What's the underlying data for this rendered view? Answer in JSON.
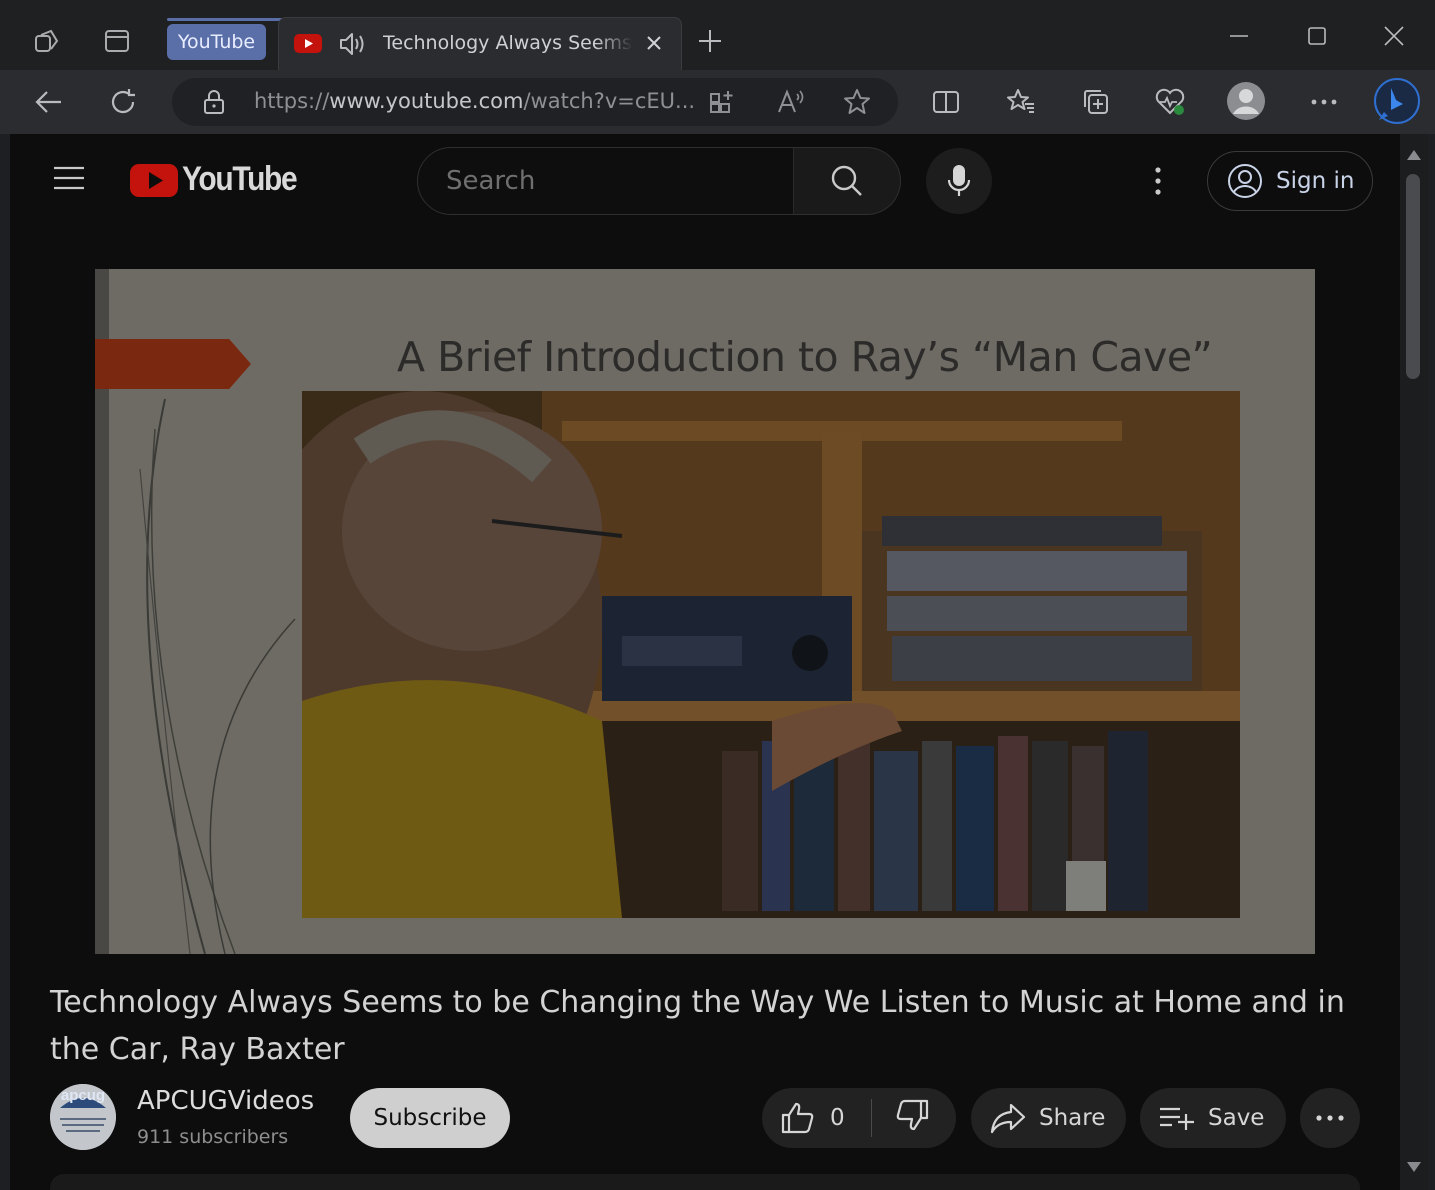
{
  "browser": {
    "tab_group_label": "YouTube",
    "tab_title": "Technology Always Seems to be Changing the Way We Listen to Music at Home and in the Car, Ray Baxter",
    "url_prefix": "https://",
    "url_host": "www.youtube.com",
    "url_rest": "/watch?v=cEU..."
  },
  "youtube": {
    "logo_text": "YouTube",
    "search_placeholder": "Search",
    "sign_in_label": "Sign in"
  },
  "video": {
    "slide_title": "A Brief Introduction to Ray’s “Man Cave”",
    "title": "Technology Always Seems to be Changing the Way We Listen to Music at Home and in the Car, Ray Baxter",
    "channel_name": "APCUGVideos",
    "channel_avatar_text": "apcug",
    "subscribers": "911 subscribers",
    "subscribe_label": "Subscribe",
    "like_count": "0",
    "share_label": "Share",
    "save_label": "Save"
  },
  "colors": {
    "youtube_red": "#c4120d",
    "tab_group": "#5a6fa8",
    "page_bg": "#0d0d0d"
  }
}
